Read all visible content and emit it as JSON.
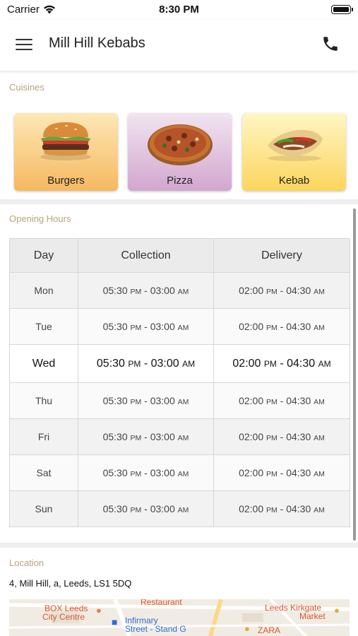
{
  "status_bar": {
    "carrier": "Carrier",
    "time": "8:30 PM"
  },
  "header": {
    "title": "Mill Hill Kebabs",
    "menu_icon": "hamburger-menu-icon",
    "call_icon": "phone-icon"
  },
  "cuisines": {
    "section_title": "Cuisines",
    "items": [
      {
        "label": "Burgers",
        "icon": "burger-image"
      },
      {
        "label": "Pizza",
        "icon": "pizza-image"
      },
      {
        "label": "Kebab",
        "icon": "kebab-image"
      }
    ]
  },
  "opening_hours": {
    "section_title": "Opening Hours",
    "columns": [
      "Day",
      "Collection",
      "Delivery"
    ],
    "rows": [
      {
        "day": "Mon",
        "c_open": "05:30",
        "c_open_ap": "PM",
        "c_close": "03:00",
        "c_close_ap": "AM",
        "d_open": "02:00",
        "d_open_ap": "PM",
        "d_close": "04:30",
        "d_close_ap": "AM"
      },
      {
        "day": "Tue",
        "c_open": "05:30",
        "c_open_ap": "PM",
        "c_close": "03:00",
        "c_close_ap": "AM",
        "d_open": "02:00",
        "d_open_ap": "PM",
        "d_close": "04:30",
        "d_close_ap": "AM"
      },
      {
        "day": "Wed",
        "c_open": "05:30",
        "c_open_ap": "PM",
        "c_close": "03:00",
        "c_close_ap": "AM",
        "d_open": "02:00",
        "d_open_ap": "PM",
        "d_close": "04:30",
        "d_close_ap": "AM"
      },
      {
        "day": "Thu",
        "c_open": "05:30",
        "c_open_ap": "PM",
        "c_close": "03:00",
        "c_close_ap": "AM",
        "d_open": "02:00",
        "d_open_ap": "PM",
        "d_close": "04:30",
        "d_close_ap": "AM"
      },
      {
        "day": "Fri",
        "c_open": "05:30",
        "c_open_ap": "PM",
        "c_close": "03:00",
        "c_close_ap": "AM",
        "d_open": "02:00",
        "d_open_ap": "PM",
        "d_close": "04:30",
        "d_close_ap": "AM"
      },
      {
        "day": "Sat",
        "c_open": "05:30",
        "c_open_ap": "PM",
        "c_close": "03:00",
        "c_close_ap": "AM",
        "d_open": "02:00",
        "d_open_ap": "PM",
        "d_close": "04:30",
        "d_close_ap": "AM"
      },
      {
        "day": "Sun",
        "c_open": "05:30",
        "c_open_ap": "PM",
        "c_close": "03:00",
        "c_close_ap": "AM",
        "d_open": "02:00",
        "d_open_ap": "PM",
        "d_close": "04:30",
        "d_close_ap": "AM"
      }
    ]
  },
  "location": {
    "section_title": "Location",
    "address": "4, Mill Hill, a, Leeds, LS1 5DQ",
    "map_labels": {
      "box_leeds": "BOX Leeds",
      "city_centre": "City Centre",
      "restaurant": "Restaurant",
      "infirmary": "Infirmary",
      "street_stand": "Street - Stand G",
      "kirkgate": "Leeds Kirkgate",
      "market": "Market",
      "zara": "ZARA"
    }
  },
  "colors": {
    "section_label": "#b8a47a",
    "map_poi": "#d9562d",
    "map_transit": "#2f6ed4"
  }
}
